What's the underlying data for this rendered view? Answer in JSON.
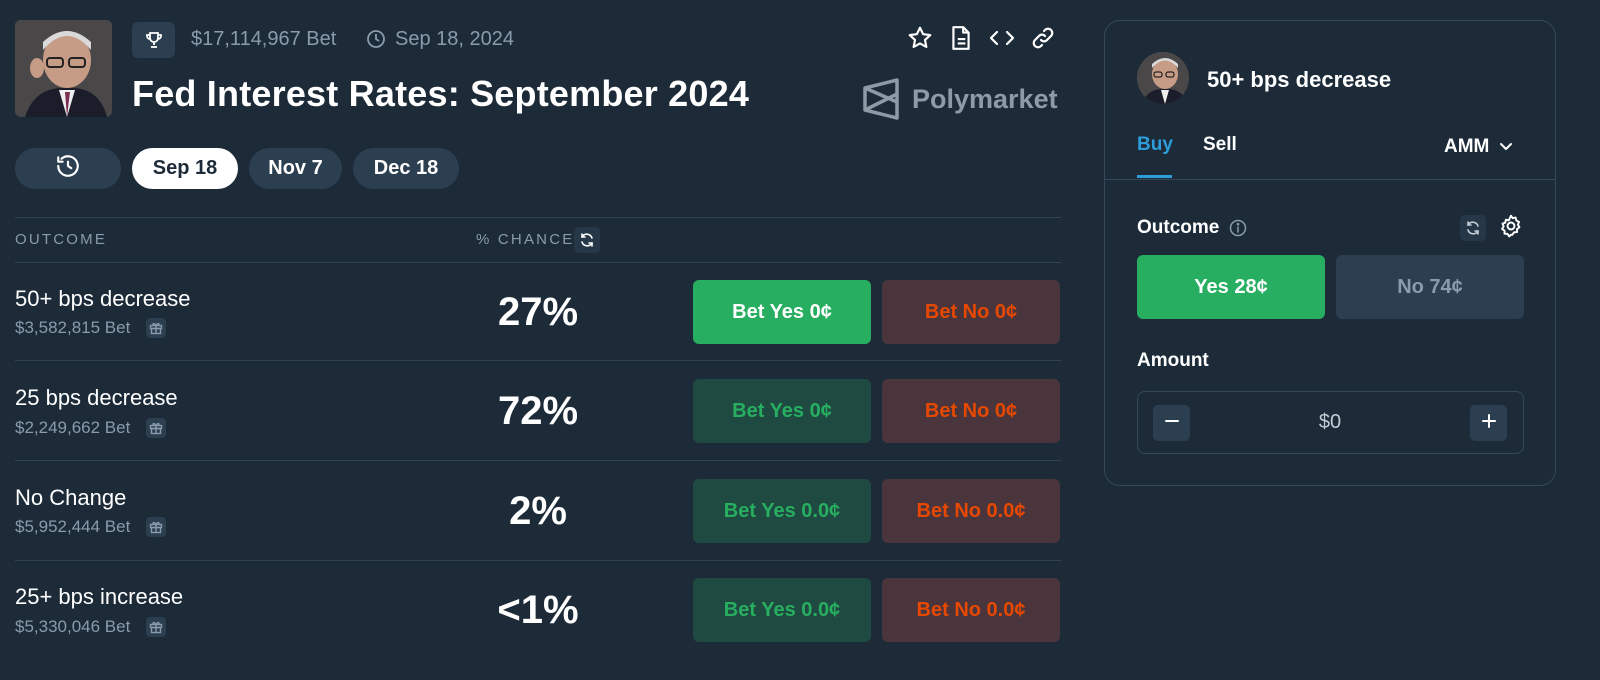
{
  "header": {
    "volume": "$17,114,967 Bet",
    "date": "Sep 18, 2024",
    "title": "Fed Interest Rates: September 2024",
    "brand": "Polymarket",
    "icons": [
      "trophy-icon",
      "clock-icon",
      "star-icon",
      "document-icon",
      "code-icon",
      "link-icon"
    ]
  },
  "date_tabs": [
    {
      "label": "",
      "icon": "history-icon",
      "active": false
    },
    {
      "label": "Sep 18",
      "active": true
    },
    {
      "label": "Nov 7",
      "active": false
    },
    {
      "label": "Dec 18",
      "active": false
    }
  ],
  "table": {
    "col_outcome": "OUTCOME",
    "col_chance": "% CHANCE",
    "rows": [
      {
        "name": "50+ bps decrease",
        "volume": "$3,582,815 Bet",
        "chance": "27%",
        "yes": "Bet Yes 0¢",
        "no": "Bet No 0¢",
        "yes_active": true
      },
      {
        "name": "25 bps decrease",
        "volume": "$2,249,662 Bet",
        "chance": "72%",
        "yes": "Bet Yes 0¢",
        "no": "Bet No 0¢",
        "yes_active": false
      },
      {
        "name": "No Change",
        "volume": "$5,952,444 Bet",
        "chance": "2%",
        "yes": "Bet Yes 0.0¢",
        "no": "Bet No 0.0¢",
        "yes_active": false
      },
      {
        "name": "25+ bps increase",
        "volume": "$5,330,046 Bet",
        "chance": "<1%",
        "yes": "Bet Yes 0.0¢",
        "no": "Bet No 0.0¢",
        "yes_active": false
      }
    ]
  },
  "panel": {
    "title": "50+ bps decrease",
    "tab_buy": "Buy",
    "tab_sell": "Sell",
    "mode": "AMM",
    "outcome_label": "Outcome",
    "yes_label": "Yes 28¢",
    "no_label": "No 74¢",
    "amount_label": "Amount",
    "amount_value": "$0"
  },
  "colors": {
    "background": "#1d2b39",
    "yes_green": "#27ae60",
    "no_orange": "#e64800",
    "accent_blue": "#2d9cdb"
  }
}
